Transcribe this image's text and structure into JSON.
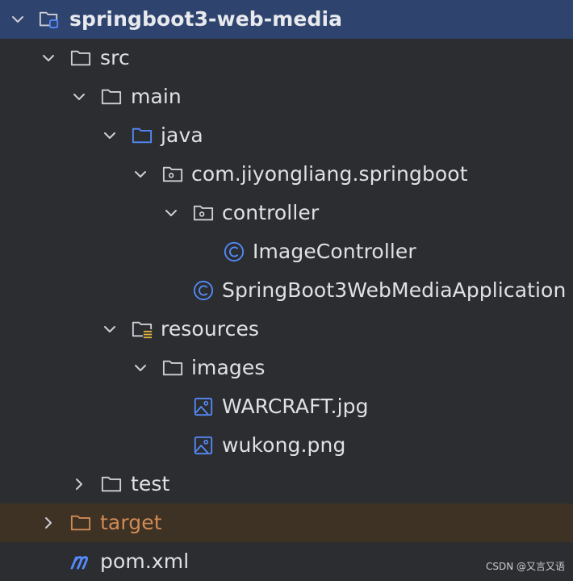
{
  "tree": {
    "root": {
      "label": "springboot3-web-media",
      "icon": "module-folder-icon"
    },
    "src": {
      "label": "src",
      "icon": "folder-icon"
    },
    "main": {
      "label": "main",
      "icon": "folder-icon"
    },
    "java": {
      "label": "java",
      "icon": "source-root-folder-icon"
    },
    "package": {
      "label": "com.jiyongliang.springboot",
      "icon": "package-icon"
    },
    "controller": {
      "label": "controller",
      "icon": "package-icon"
    },
    "image_controller": {
      "label": "ImageController",
      "icon": "class-icon"
    },
    "application": {
      "label": "SpringBoot3WebMediaApplication",
      "icon": "class-icon"
    },
    "resources": {
      "label": "resources",
      "icon": "resources-root-folder-icon"
    },
    "images": {
      "label": "images",
      "icon": "folder-icon"
    },
    "warcraft": {
      "label": "WARCRAFT.jpg",
      "icon": "image-file-icon"
    },
    "wukong": {
      "label": "wukong.png",
      "icon": "image-file-icon"
    },
    "test": {
      "label": "test",
      "icon": "folder-icon"
    },
    "target": {
      "label": "target",
      "icon": "excluded-folder-icon"
    },
    "pom": {
      "label": "pom.xml",
      "icon": "maven-icon"
    }
  },
  "watermark": "CSDN @又言又语",
  "colors": {
    "background": "#2b2d30",
    "selected_row": "#2e436e",
    "excluded_row": "#3d3223",
    "text": "#dfe1e5",
    "excluded_text": "#d18a56",
    "accent_blue": "#548af7"
  }
}
